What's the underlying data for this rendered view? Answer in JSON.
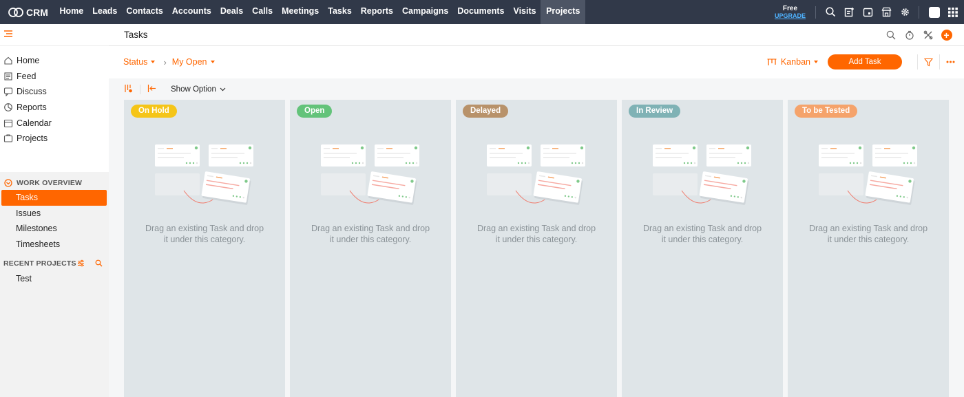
{
  "app": {
    "name": "CRM"
  },
  "nav": {
    "items": [
      "Home",
      "Leads",
      "Contacts",
      "Accounts",
      "Deals",
      "Calls",
      "Meetings",
      "Tasks",
      "Reports",
      "Campaigns",
      "Documents",
      "Visits",
      "Projects"
    ],
    "active": "Projects",
    "plan_label": "Free",
    "upgrade_label": "UPGRADE"
  },
  "sidebar": {
    "menu": [
      {
        "label": "Home",
        "icon": "home-icon"
      },
      {
        "label": "Feed",
        "icon": "feed-icon"
      },
      {
        "label": "Discuss",
        "icon": "discuss-icon"
      },
      {
        "label": "Reports",
        "icon": "reports-icon"
      },
      {
        "label": "Calendar",
        "icon": "calendar-icon"
      },
      {
        "label": "Projects",
        "icon": "projects-icon"
      }
    ],
    "work_overview_title": "WORK OVERVIEW",
    "work_overview_items": [
      "Tasks",
      "Issues",
      "Milestones",
      "Timesheets"
    ],
    "active_item": "Tasks",
    "recent_projects_title": "RECENT PROJECTS",
    "recent_projects": [
      "Test"
    ]
  },
  "page": {
    "title": "Tasks",
    "filter_status": "Status",
    "filter_view": "My Open",
    "view_mode": "Kanban",
    "add_task_label": "Add Task",
    "show_option_label": "Show Option"
  },
  "columns": [
    {
      "title": "On Hold",
      "color": "#f5c518",
      "empty_text": "Drag an existing Task and drop it under this category."
    },
    {
      "title": "Open",
      "color": "#63c37a",
      "empty_text": "Drag an existing Task and drop it under this category."
    },
    {
      "title": "Delayed",
      "color": "#b8926a",
      "empty_text": "Drag an existing Task and drop it under this category."
    },
    {
      "title": "In Review",
      "color": "#7fb2b5",
      "empty_text": "Drag an existing Task and drop it under this category."
    },
    {
      "title": "To be Tested",
      "color": "#f5a36b",
      "empty_text": "Drag an existing Task and drop it under this category."
    }
  ],
  "colors": {
    "accent": "#ff6600",
    "topbar": "#313949",
    "column_bg": "#dfe5e8"
  }
}
